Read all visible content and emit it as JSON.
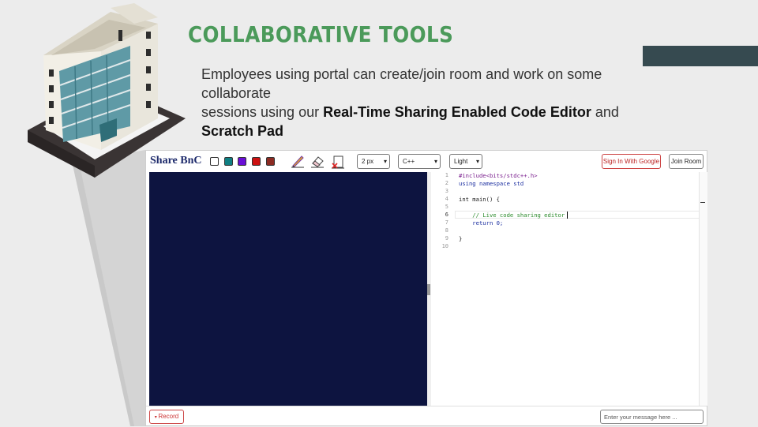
{
  "slide": {
    "title": "COLLABORATIVE TOOLS",
    "subtitle_line1": "Employees using portal can create/join room and work on some collaborate",
    "subtitle_line2_pre": "sessions using our ",
    "subtitle_bold1": "Real-Time Sharing Enabled Code Editor",
    "subtitle_mid": " and ",
    "subtitle_bold2": "Scratch Pad"
  },
  "app": {
    "title": "Share BnC",
    "swatches": [
      {
        "name": "white",
        "color": "#ffffff"
      },
      {
        "name": "teal",
        "color": "#0f7f82"
      },
      {
        "name": "purple",
        "color": "#6a0fd6"
      },
      {
        "name": "red",
        "color": "#cc1111"
      },
      {
        "name": "brown",
        "color": "#8b2b22"
      }
    ],
    "tools": [
      "pencil-icon",
      "eraser-icon",
      "clear-page-icon"
    ],
    "brush_size": "2 px",
    "language": "C++",
    "theme": "Light",
    "sign_in_label": "Sign In With Google",
    "join_room_label": "Join Room",
    "record_label": "Record",
    "message_placeholder": "Enter your message here ..."
  },
  "editor": {
    "line_numbers": [
      "1",
      "2",
      "3",
      "4",
      "5",
      "6",
      "7",
      "8",
      "9",
      "10"
    ],
    "lines": [
      "#include<bits/stdc++.h>",
      "using namespace std",
      "",
      "int main() {",
      "",
      "    // Live code sharing editor",
      "    return 0;",
      "",
      "}",
      ""
    ]
  },
  "colors": {
    "title_green": "#4b9a5a",
    "canvas_navy": "#0d1440",
    "band_slate": "#364a50"
  }
}
